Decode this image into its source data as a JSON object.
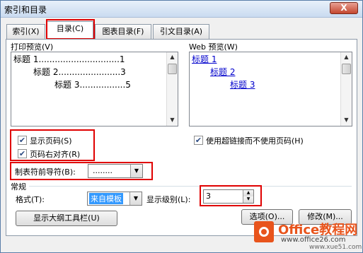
{
  "window": {
    "title": "索引和目录",
    "close_glyph": "X"
  },
  "tabs": [
    {
      "label": "索引(X)"
    },
    {
      "label": "目录(C)"
    },
    {
      "label": "图表目录(F)"
    },
    {
      "label": "引文目录(A)"
    }
  ],
  "print_preview": {
    "label": "打印预览(V)",
    "lines": [
      "标题 1..............................1",
      "标题 2.......................3",
      "标题 3.................5"
    ]
  },
  "web_preview": {
    "label": "Web 预览(W)",
    "lines": [
      "标题 1",
      "标题 2",
      "标题 3"
    ]
  },
  "options": {
    "show_page_numbers": {
      "label": "显示页码(S)",
      "checked": true
    },
    "right_align": {
      "label": "页码右对齐(R)",
      "checked": true
    },
    "use_hyperlinks": {
      "label": "使用超链接而不使用页码(H)",
      "checked": true
    },
    "tab_leader": {
      "label": "制表符前导符(B):",
      "value": "........"
    }
  },
  "general": {
    "label": "常规",
    "format_label": "格式(T):",
    "format_value": "来自模板",
    "levels_label": "显示级别(L):",
    "levels_value": "3"
  },
  "buttons": {
    "outline_toolbar": "显示大纲工具栏(U)",
    "options": "选项(O)...",
    "modify": "修改(M)..."
  },
  "watermark": {
    "brand": "Office教程网",
    "url": "www.office26.com",
    "sub": "www.xue51.com"
  },
  "colors": {
    "highlight": "#e00000",
    "link": "#0000cc",
    "watermark": "#e8541c"
  }
}
